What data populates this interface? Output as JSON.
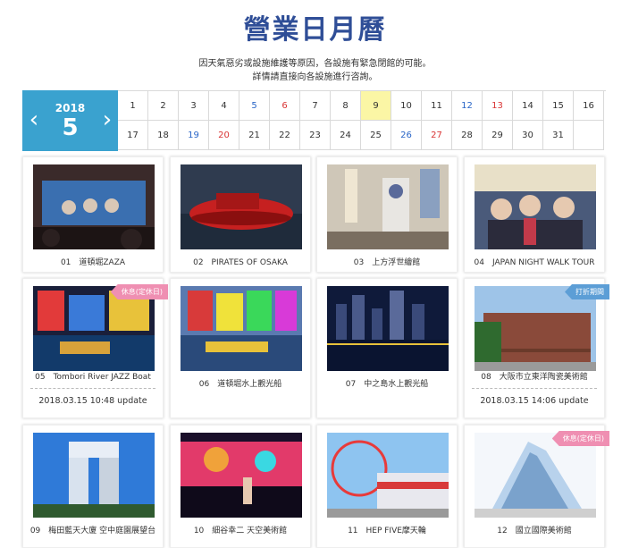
{
  "page": {
    "title": "營業日月曆",
    "notice_line1": "因天氣惡劣或設施維護等原因，各設施有緊急閉館的可能。",
    "notice_line2": "詳情請直接向各設施進行咨詢。"
  },
  "calendar": {
    "year": "2018",
    "month": "5",
    "prev_icon": "chevron-left-icon",
    "next_icon": "chevron-right-icon",
    "days": [
      "1",
      "2",
      "3",
      "4",
      "5",
      "6",
      "7",
      "8",
      "9",
      "10",
      "11",
      "12",
      "13",
      "14",
      "15",
      "16",
      "17",
      "18",
      "19",
      "20",
      "21",
      "22",
      "23",
      "24",
      "25",
      "26",
      "27",
      "28",
      "29",
      "30",
      "31"
    ],
    "saturdays": [
      "5",
      "12",
      "19",
      "26"
    ],
    "sundays": [
      "6",
      "13",
      "20",
      "27"
    ],
    "today": "9",
    "colors": {
      "header": "#3aa2cf",
      "today": "#fbf6a5",
      "saturday": "#2a66c7",
      "sunday": "#d93535"
    }
  },
  "facilities": [
    {
      "label": "01　道頓堀ZAZA",
      "badge": "",
      "update": ""
    },
    {
      "label": "02　PIRATES OF OSAKA",
      "badge": "",
      "update": ""
    },
    {
      "label": "03　上方浮世繪館",
      "badge": "",
      "update": ""
    },
    {
      "label": "04　JAPAN NIGHT WALK TOUR",
      "badge": "",
      "update": ""
    },
    {
      "label": "05　Tombori River JAZZ Boat",
      "badge": "休息(定休日)",
      "update": "2018.03.15 10:48 update"
    },
    {
      "label": "06　道頓堀水上觀光船",
      "badge": "",
      "update": ""
    },
    {
      "label": "07　中之島水上觀光船",
      "badge": "",
      "update": ""
    },
    {
      "label": "08　大阪市立東洋陶瓷美術館",
      "badge": "打折期間",
      "update": "2018.03.15 14:06 update"
    },
    {
      "label": "09　梅田藍天大廈 空中庭園展望台",
      "badge": "",
      "update": ""
    },
    {
      "label": "10　細谷幸二 天空美術館",
      "badge": "",
      "update": ""
    },
    {
      "label": "11　HEP FIVE摩天輪",
      "badge": "",
      "update": ""
    },
    {
      "label": "12　國立國際美術館",
      "badge": "休息(定休日)",
      "update": ""
    }
  ]
}
